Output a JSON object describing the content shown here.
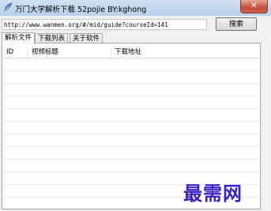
{
  "window": {
    "title": "万门大学解析下载 52pojie BY:kghong",
    "close_glyph": "✕",
    "accent_color": "#3a22c9"
  },
  "toolbar": {
    "url_value": "http://www.wanmen.org/#/mid/guide?courseId=141",
    "search_label": "搜索"
  },
  "tabs": [
    {
      "label": "解析文件"
    },
    {
      "label": "下载列表"
    },
    {
      "label": "关于软件"
    }
  ],
  "list": {
    "columns": [
      {
        "label": "ID"
      },
      {
        "label": "视频标题"
      },
      {
        "label": "下载地址"
      }
    ]
  },
  "watermark": {
    "text": "最需网"
  }
}
